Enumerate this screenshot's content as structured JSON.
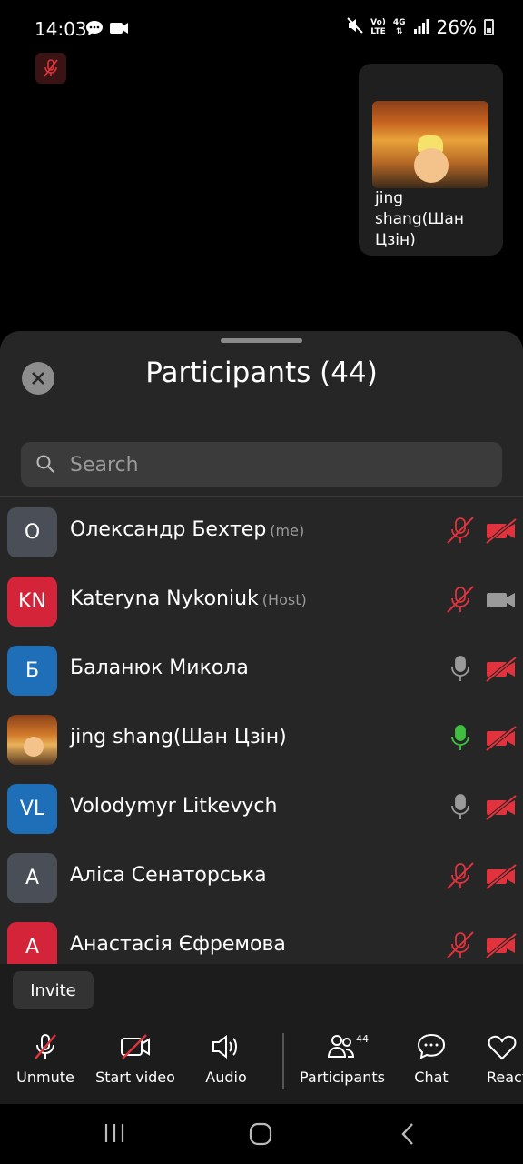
{
  "status_bar": {
    "time": "14:03",
    "network_top": "Vo)",
    "network_bottom": "LTE",
    "signal_label": "4G",
    "battery": "26%"
  },
  "video_tile": {
    "name": "jing shang(Шан Цзін)"
  },
  "panel": {
    "title": "Participants (44)",
    "search_placeholder": "Search"
  },
  "participants": [
    {
      "initials": "O",
      "name": "Олександр Бехтер",
      "role": "(me)",
      "avatar_color": "#4a4f57",
      "mic": "muted",
      "video": "off"
    },
    {
      "initials": "KN",
      "name": "Kateryna Nykoniuk",
      "role": "(Host)",
      "avatar_color": "#d3243a",
      "mic": "muted",
      "video": "on"
    },
    {
      "initials": "Б",
      "name": "Баланюк Микола",
      "role": "",
      "avatar_color": "#1f6fb8",
      "mic": "idle",
      "video": "off"
    },
    {
      "initials": "",
      "name": "jing shang(Шан Цзін)",
      "role": "",
      "avatar_color": "photo",
      "mic": "speaking",
      "video": "off"
    },
    {
      "initials": "VL",
      "name": "Volodymyr Litkevych",
      "role": "",
      "avatar_color": "#1f6fb8",
      "mic": "idle",
      "video": "off"
    },
    {
      "initials": "A",
      "name": "Аліса Сенаторська",
      "role": "",
      "avatar_color": "#4a4f57",
      "mic": "muted",
      "video": "off"
    },
    {
      "initials": "А",
      "name": "Анастасія Єфремова",
      "role": "",
      "avatar_color": "#d3243a",
      "mic": "muted",
      "video": "off"
    }
  ],
  "invite": {
    "label": "Invite"
  },
  "toolbar": {
    "unmute": "Unmute",
    "start_video": "Start video",
    "audio": "Audio",
    "participants": "Participants",
    "participants_count": "44",
    "chat": "Chat",
    "reactions": "React"
  },
  "colors": {
    "muted_red": "#e0333d",
    "speaking_green": "#3fbf3f",
    "idle_gray": "#9a9a9a"
  }
}
